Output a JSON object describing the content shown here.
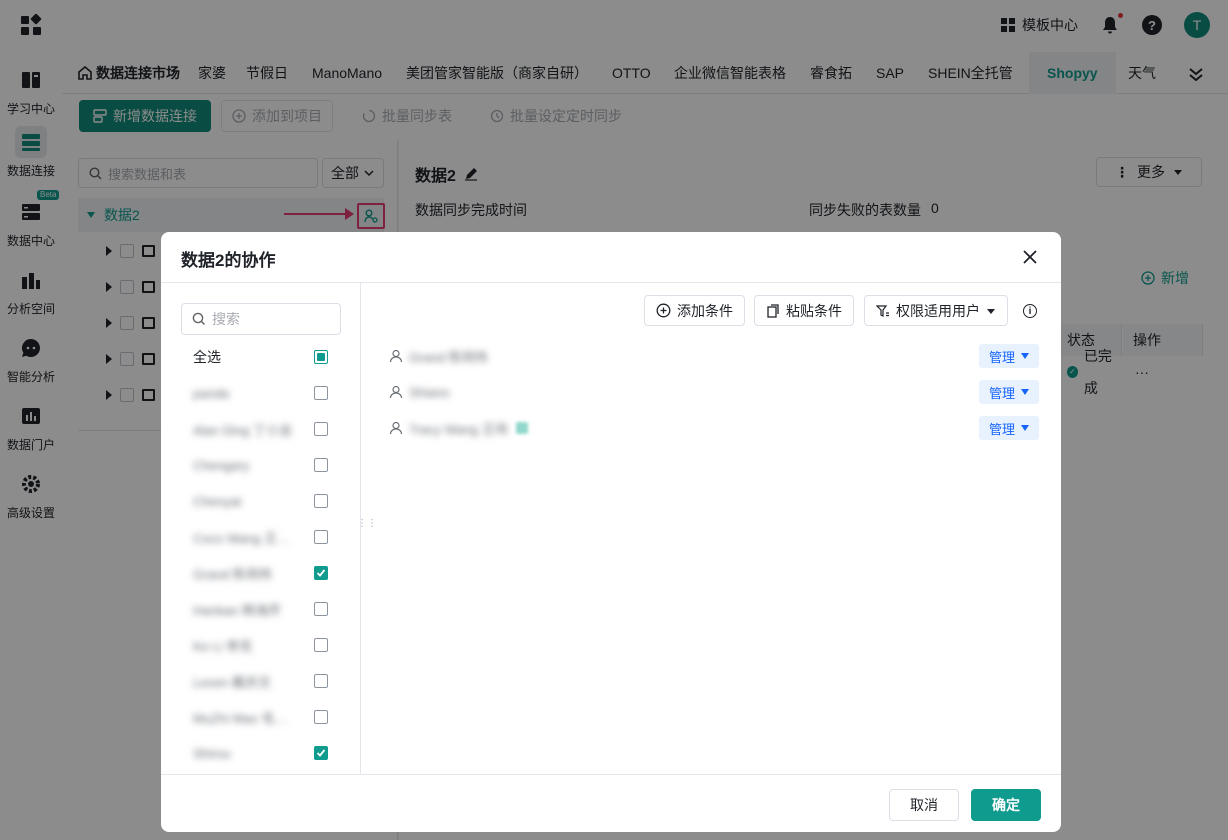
{
  "topbar": {
    "template_center": "模板中心",
    "avatar_letter": "T"
  },
  "leftnav": {
    "items": [
      {
        "label": "学习中心",
        "icon": "book-icon"
      },
      {
        "label": "数据连接",
        "icon": "data-connect-icon"
      },
      {
        "label": "数据中心",
        "icon": "server-icon",
        "badge": "Beta"
      },
      {
        "label": "分析空间",
        "icon": "chart-icon"
      },
      {
        "label": "智能分析",
        "icon": "chat-icon"
      },
      {
        "label": "数据门户",
        "icon": "portal-icon"
      },
      {
        "label": "高级设置",
        "icon": "gear-icon"
      }
    ]
  },
  "tabs": [
    "数据连接市场",
    "家婆",
    "节假日",
    "ManoMano",
    "美团管家智能版（商家自研）",
    "OTTO",
    "企业微信智能表格",
    "睿食拓",
    "SAP",
    "SHEIN全托管",
    "Shopyy",
    "天气"
  ],
  "toolbar": {
    "new_connection": "新增数据连接",
    "add_to_project": "添加到项目",
    "batch_sync": "批量同步表",
    "batch_schedule": "批量设定定时同步"
  },
  "left_panel": {
    "search_placeholder": "搜索数据和表",
    "filter": "全部",
    "tree_root": "数据2"
  },
  "right_panel": {
    "title": "数据2",
    "more": "更多",
    "sync_done_label": "数据同步完成时间",
    "failed_tables_label": "同步失败的表数量",
    "failed_tables_value": "0",
    "add_new": "新增",
    "col_status": "状态",
    "col_action": "操作",
    "row_status": "已完成",
    "row_action": "···"
  },
  "modal": {
    "title": "数据2的协作",
    "search_placeholder": "搜索",
    "select_all": "全选",
    "members": [
      {
        "name": "panda",
        "checked": false
      },
      {
        "name": "Alan Ding 丁小龙",
        "checked": false
      },
      {
        "name": "Chengary",
        "checked": false
      },
      {
        "name": "Chenyat",
        "checked": false
      },
      {
        "name": "Coco Wang 王…",
        "checked": false
      },
      {
        "name": "Grand 陈玥伟",
        "checked": true
      },
      {
        "name": "Hanban 韩海芹",
        "checked": false
      },
      {
        "name": "Ke Li 李克",
        "checked": false
      },
      {
        "name": "Lexen 戴庆文",
        "checked": false
      },
      {
        "name": "MuZhi Mao 毛…",
        "checked": false
      },
      {
        "name": "Shirou",
        "checked": true
      }
    ],
    "add_condition": "添加条件",
    "paste_condition": "粘贴条件",
    "perm_users": "权限适用用户",
    "users": [
      {
        "name": "Grand 陈玥伟",
        "role": "管理"
      },
      {
        "name": "Shiano",
        "role": "管理"
      },
      {
        "name": "Tracy Wang 王玮",
        "role": "管理"
      }
    ],
    "cancel": "取消",
    "confirm": "确定"
  },
  "colors": {
    "accent": "#0f9b8e",
    "highlight": "#e83c72",
    "role_blue": "#1664ff"
  }
}
